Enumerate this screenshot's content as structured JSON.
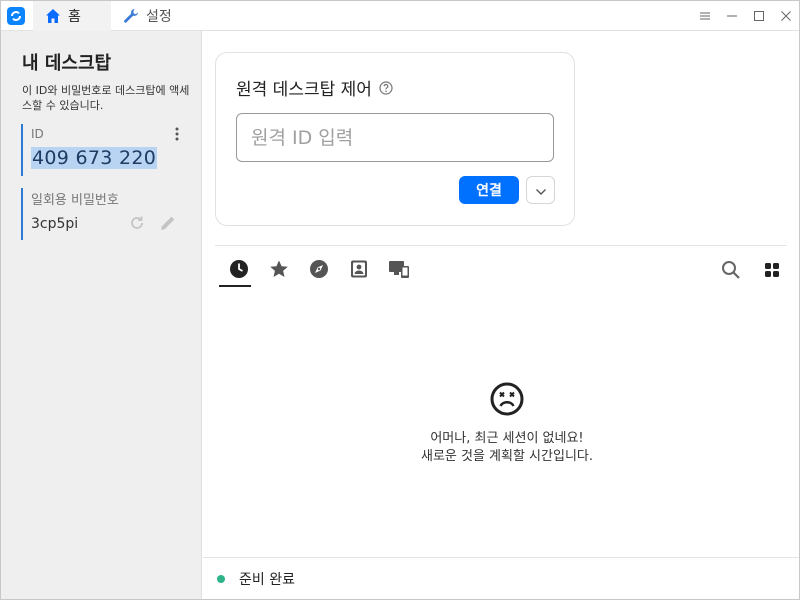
{
  "titlebar": {
    "tabs": [
      {
        "label": "홈",
        "icon": "home-icon",
        "active": true
      },
      {
        "label": "설정",
        "icon": "wrench-icon",
        "active": false
      }
    ],
    "controls": [
      "menu-icon",
      "minimize-icon",
      "maximize-icon",
      "close-icon"
    ]
  },
  "sidebar": {
    "title": "내 데스크탑",
    "description": "이 ID와 비밀번호로 데스크탑에 액세스할 수 있습니다.",
    "id_label": "ID",
    "id_value": "409 673 220",
    "password_label": "일회용 비밀번호",
    "password_value": "3cp5pi"
  },
  "remote": {
    "title": "원격 데스크탑 제어",
    "input_placeholder": "원격 ID 입력",
    "input_value": "",
    "connect_label": "연결"
  },
  "peers": {
    "tabs": [
      "recent-sessions-icon",
      "favorites-icon",
      "discovered-icon",
      "address-book-icon",
      "accessible-devices-icon"
    ],
    "active_tab": 0,
    "empty_line1": "어머나, 최근 세션이 없네요!",
    "empty_line2": "새로운 것을 계획할 시간입니다."
  },
  "status": {
    "text": "준비 완료",
    "color": "#2fb38a"
  },
  "colors": {
    "accent": "#0071ff",
    "sidebar_bg": "#efefef"
  }
}
